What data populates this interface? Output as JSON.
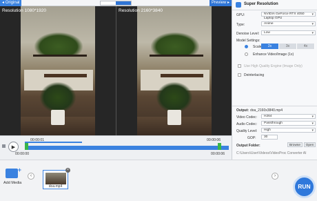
{
  "preview_bar": {
    "original_label": "Original",
    "preview_label": "Preview"
  },
  "left_pane": {
    "resolution": "Resolution 1080*1920"
  },
  "right_pane": {
    "resolution": "Resolution 2160*3840"
  },
  "timeline": {
    "time_current": "00:00:01",
    "time_start": "00:00:00",
    "time_end": "00:00:06",
    "time_end_right": "00:00:06",
    "progress": 0.28
  },
  "media": {
    "add_label": "Add Media",
    "thumb_name": "doa.mp4"
  },
  "run_label": "RUN",
  "panel": {
    "title": "Super Resolution",
    "gpu_label": "GPU:",
    "gpu_value": "NVIDIA GeForce RTX 4050 Laptop GPU",
    "type_label": "Type:",
    "type_value": "Anime",
    "denoise_label": "Denoise Level:",
    "denoise_value": "Low",
    "model_label": "Model Settings:",
    "scale_label": "Scale",
    "scale_options": [
      "2x",
      "3x",
      "4x"
    ],
    "enhance_label": "Enhance Video/Image (1x)",
    "hq_label": "Use High Quality Engine (Image Only)",
    "deinterlacing_label": "Deinterlacing",
    "output_label": "Output:",
    "output_value": "doa_2160x3840.mp4",
    "vcodec_label": "Video Codec:",
    "vcodec_value": "H264",
    "acodec_label": "Audio Codec:",
    "acodec_value": "Passthrough",
    "quality_label": "Quality Level:",
    "quality_value": "High",
    "gop_label": "GOP:",
    "gop_value": "30",
    "folder_label": "Output Folder:",
    "browse_label": "Browse",
    "open_label": "Open",
    "folder_path": "C:\\Users\\User\\Videos\\VideoProc Converter AI",
    "accent": "#3a82e0"
  }
}
